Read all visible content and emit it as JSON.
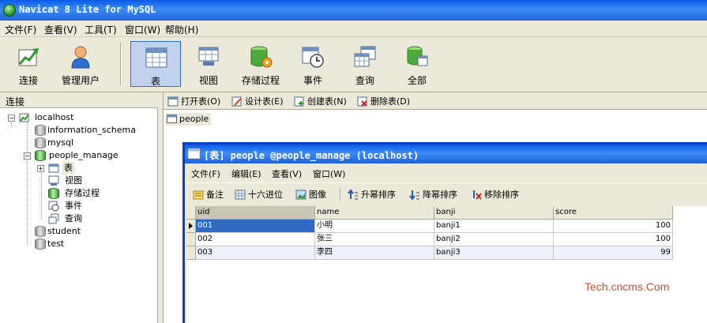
{
  "window": {
    "title": "Navicat 8 Lite for MySQL"
  },
  "menubar": [
    {
      "label": "文件(F)"
    },
    {
      "label": "查看(V)"
    },
    {
      "label": "工具(T)"
    },
    {
      "label": "窗口(W)"
    },
    {
      "label": "帮助(H)"
    }
  ],
  "toolbar": {
    "items": [
      {
        "label": "连接",
        "icon": "connect-icon"
      },
      {
        "label": "管理用户",
        "icon": "user-icon"
      },
      {
        "label": "表",
        "icon": "table-icon",
        "active": true
      },
      {
        "label": "视图",
        "icon": "view-icon"
      },
      {
        "label": "存储过程",
        "icon": "procedure-icon"
      },
      {
        "label": "事件",
        "icon": "event-icon"
      },
      {
        "label": "查询",
        "icon": "query-icon"
      },
      {
        "label": "全部",
        "icon": "all-icon"
      }
    ]
  },
  "sidebar": {
    "header": "连接",
    "tree": {
      "root": "localhost",
      "databases": [
        "information_schema",
        "mysql",
        "people_manage",
        "student",
        "test"
      ],
      "people_manage_children": [
        "表",
        "视图",
        "存储过程",
        "事件",
        "查询"
      ]
    }
  },
  "objects_toolbar": {
    "open_table": "打开表(O)",
    "design_table": "设计表(E)",
    "create_table": "创建表(N)",
    "delete_table": "删除表(D)"
  },
  "objects": [
    {
      "name": "people"
    }
  ],
  "table_window": {
    "title": "[表] people @people_manage (localhost)",
    "menu": [
      "文件(F)",
      "编辑(E)",
      "查看(V)",
      "窗口(W)"
    ],
    "toolbar": {
      "memo": "备注",
      "hex": "十六进位",
      "image": "图像",
      "sort_asc": "升幂排序",
      "sort_desc": "降幂排序",
      "remove_sort": "移除排序"
    },
    "grid": {
      "columns": [
        "uid",
        "name",
        "banji",
        "score"
      ],
      "rows": [
        [
          "001",
          "小明",
          "banji1",
          "100"
        ],
        [
          "002",
          "张三",
          "banji2",
          "100"
        ],
        [
          "003",
          "李四",
          "banji3",
          "99"
        ]
      ]
    }
  },
  "watermark": "Tech.cncms.Com"
}
